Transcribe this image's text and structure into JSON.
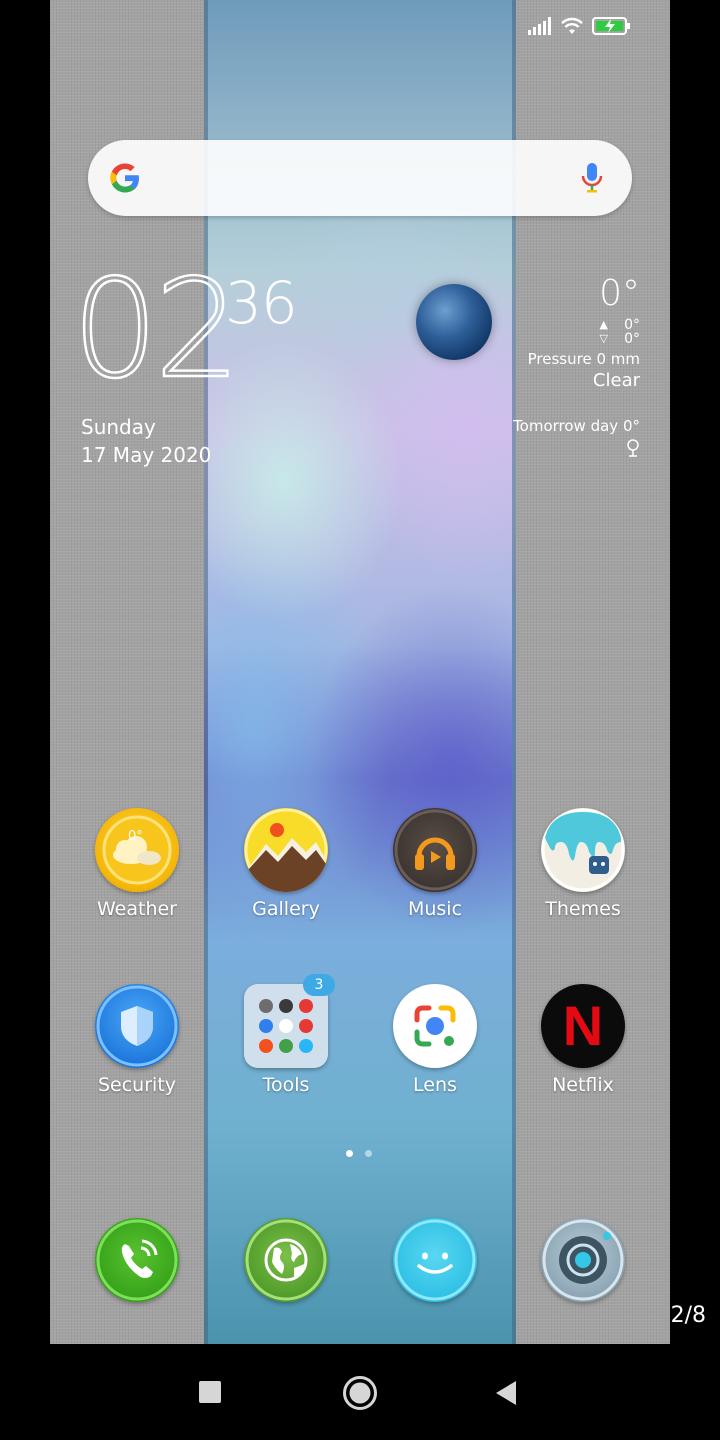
{
  "status_bar": {
    "icons": [
      "signal-icon",
      "wifi-icon",
      "battery-charging-icon"
    ]
  },
  "search_bar": {
    "logo": "google-g-logo",
    "mic": "microphone-icon"
  },
  "clock": {
    "hours": "02",
    "minutes": "36",
    "day": "Sunday",
    "date": "17 May 2020"
  },
  "weather": {
    "temp": "0°",
    "high": "0°",
    "low": "0°",
    "pressure": "Pressure 0 mm",
    "condition": "Clear",
    "tomorrow": "Tomorrow day 0°",
    "pin_icon": "location-pin-icon"
  },
  "apps_row1": [
    {
      "label": "Weather",
      "icon": "weather-icon"
    },
    {
      "label": "Gallery",
      "icon": "gallery-icon"
    },
    {
      "label": "Music",
      "icon": "music-icon"
    },
    {
      "label": "Themes",
      "icon": "themes-icon"
    }
  ],
  "apps_row2": [
    {
      "label": "Security",
      "icon": "security-shield-icon"
    },
    {
      "label": "Tools",
      "icon": "folder-icon",
      "badge": "3"
    },
    {
      "label": "Lens",
      "icon": "lens-icon"
    },
    {
      "label": "Netflix",
      "icon": "netflix-icon"
    }
  ],
  "weather_icon_text": "0°",
  "netflix_letter": "N",
  "dock": [
    {
      "icon": "phone-icon"
    },
    {
      "icon": "browser-globe-icon"
    },
    {
      "icon": "messaging-smile-icon"
    },
    {
      "icon": "camera-icon"
    }
  ],
  "page_indicator": {
    "pages": 2,
    "active": 1
  },
  "page_counter": "2/8",
  "nav": {
    "buttons": [
      "recents-button",
      "home-button",
      "back-button"
    ]
  },
  "colors": {
    "netflix_red": "#e50914",
    "accent_blue": "#2f80ed",
    "badge_blue": "#3fa9e6"
  }
}
